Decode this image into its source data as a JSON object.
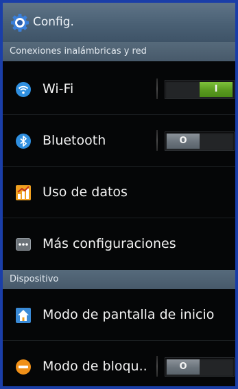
{
  "action_bar": {
    "title": "Config.",
    "icon": "gear-icon"
  },
  "sections": {
    "wireless": "Conexiones inalámbricas y red",
    "device": "Dispositivo"
  },
  "rows": {
    "wifi": {
      "label": "Wi-Fi",
      "icon": "wifi-icon",
      "toggle": "I",
      "state": "on"
    },
    "bluetooth": {
      "label": "Bluetooth",
      "icon": "bluetooth-icon",
      "toggle": "O",
      "state": "off"
    },
    "data_usage": {
      "label": "Uso de datos",
      "icon": "data-usage-icon"
    },
    "more_settings": {
      "label": "Más configuraciones",
      "icon": "more-icon"
    },
    "home_screen": {
      "label": "Modo de pantalla de inicio",
      "icon": "home-icon"
    },
    "lock_mode": {
      "label": "Modo de bloqu..",
      "icon": "block-icon",
      "toggle": "O",
      "state": "off"
    }
  },
  "colors": {
    "background": "#050607",
    "frame": "#1a3ea8",
    "toggle_on": "#5a9a1f",
    "toggle_off": "#6a737b"
  }
}
